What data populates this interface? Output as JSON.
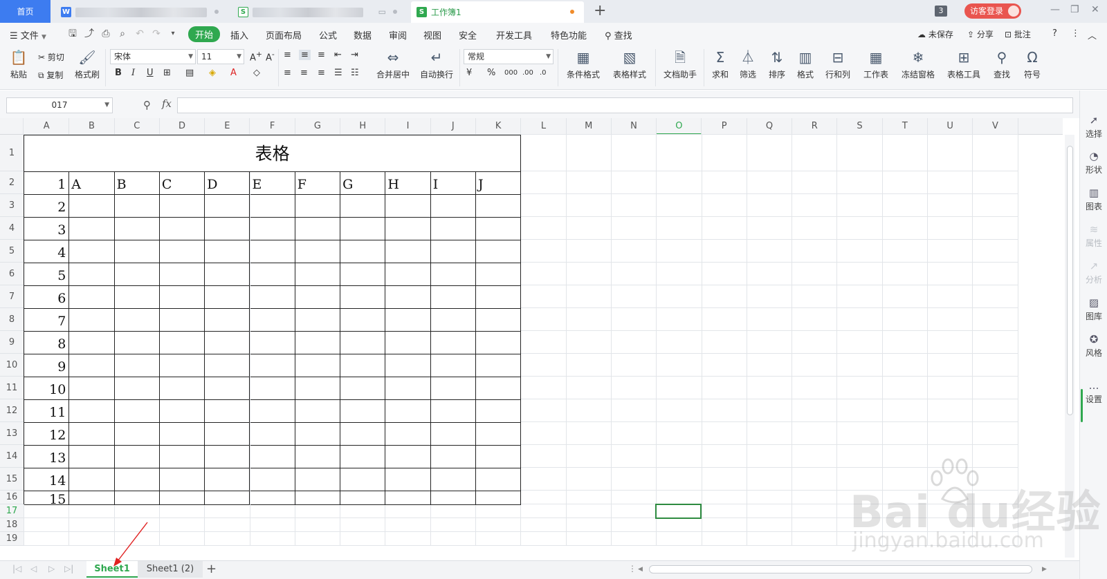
{
  "titlebar": {
    "home_tab": "首页",
    "doc1_icon": "W",
    "doc2_icon": "S",
    "workbook_icon": "S",
    "workbook_tab": "工作簿1",
    "new_tab": "+",
    "window_count": "3",
    "guest_login": "访客登录"
  },
  "menubar": {
    "file": "文件",
    "tabs": [
      "开始",
      "插入",
      "页面布局",
      "公式",
      "数据",
      "审阅",
      "视图",
      "安全",
      "开发工具",
      "特色功能"
    ],
    "search": "查找",
    "unsaved": "未保存",
    "share": "分享",
    "comment": "批注"
  },
  "ribbon": {
    "paste": "粘贴",
    "cut": "剪切",
    "copy": "复制",
    "format_painter": "格式刷",
    "font_name": "宋体",
    "font_size": "11",
    "merge_center": "合并居中",
    "wrap_text": "自动换行",
    "number_format": "常规",
    "conditional_format": "条件格式",
    "table_style": "表格样式",
    "doc_assistant": "文档助手",
    "sum": "求和",
    "filter": "筛选",
    "sort": "排序",
    "format": "格式",
    "row_col": "行和列",
    "worksheet": "工作表",
    "freeze": "冻结窗格",
    "table_tools": "表格工具",
    "find": "查找",
    "symbol": "符号"
  },
  "formula_bar": {
    "name_box": "017",
    "fx": "fx",
    "value": ""
  },
  "grid": {
    "columns": [
      "A",
      "B",
      "C",
      "D",
      "E",
      "F",
      "G",
      "H",
      "I",
      "J",
      "K",
      "L",
      "M",
      "N",
      "O",
      "P",
      "Q",
      "R",
      "S",
      "T",
      "U",
      "V"
    ],
    "selected_column": "O",
    "rows": [
      "1",
      "2",
      "3",
      "4",
      "5",
      "6",
      "7",
      "8",
      "9",
      "10",
      "11",
      "12",
      "13",
      "14",
      "15",
      "16",
      "17",
      "18",
      "19"
    ],
    "selected_row": "17",
    "table_title": "表格",
    "header_row": [
      "1",
      "A",
      "B",
      "C",
      "D",
      "E",
      "F",
      "G",
      "H",
      "I",
      "J"
    ],
    "row_numbers": [
      "2",
      "3",
      "4",
      "5",
      "6",
      "7",
      "8",
      "9",
      "10",
      "11",
      "12",
      "13",
      "14",
      "15"
    ]
  },
  "sidepanel": {
    "items": [
      "选择",
      "形状",
      "图表",
      "属性",
      "分析",
      "图库",
      "风格",
      "设置"
    ]
  },
  "sheets": {
    "tabs": [
      "Sheet1",
      "Sheet1 (2)"
    ],
    "active": "Sheet1",
    "add": "+"
  },
  "watermark": {
    "brand": "Bai du经验",
    "url": "jingyan.baidu.com"
  },
  "colors": {
    "accent": "#2fa84f",
    "home_tab": "#3d7cf0",
    "guest": "#e9554f",
    "annotation_arrow": "#e02020"
  }
}
